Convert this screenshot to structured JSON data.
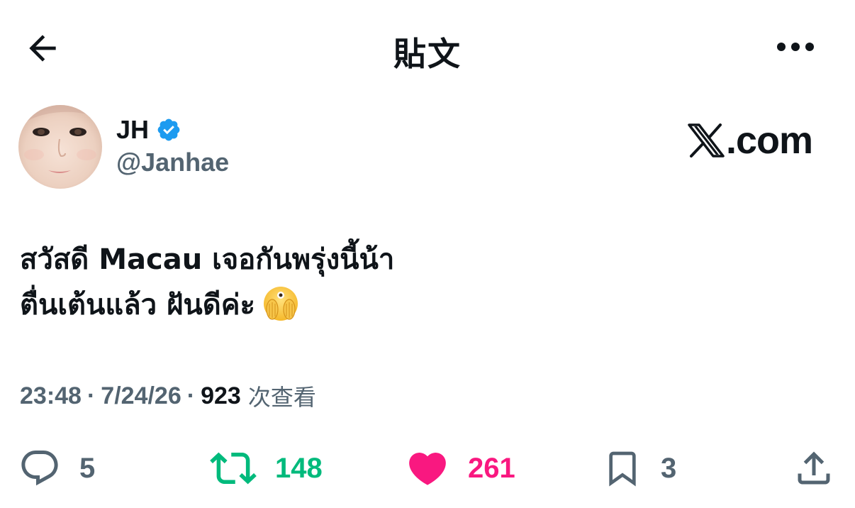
{
  "header": {
    "title": "貼文",
    "back_icon": "arrow-left-icon",
    "more_icon": "more-horizontal-icon"
  },
  "author": {
    "name": "JH",
    "handle": "@Janhae",
    "verified": true,
    "verified_color": "#1d9bf0"
  },
  "watermark": {
    "text": ".com",
    "logo_icon": "x-logo-icon"
  },
  "tweet": {
    "lines": [
      "สวัสดี Macau เจอกันพรุ่งนี้น้า",
      "ตื่นเต้นแล้ว ฝันดีค่ะ"
    ],
    "emoji": "face-with-open-eyes-and-hand-over-mouth-icon"
  },
  "meta": {
    "time": "23:48",
    "date": "7/24/26",
    "separator": "·",
    "views": "923",
    "views_label": "次查看"
  },
  "actions": {
    "replies": "5",
    "reposts": "148",
    "likes": "261",
    "bookmarks": "3",
    "repost_color": "#00ba7c",
    "like_color": "#f91880",
    "muted_color": "#536471"
  }
}
